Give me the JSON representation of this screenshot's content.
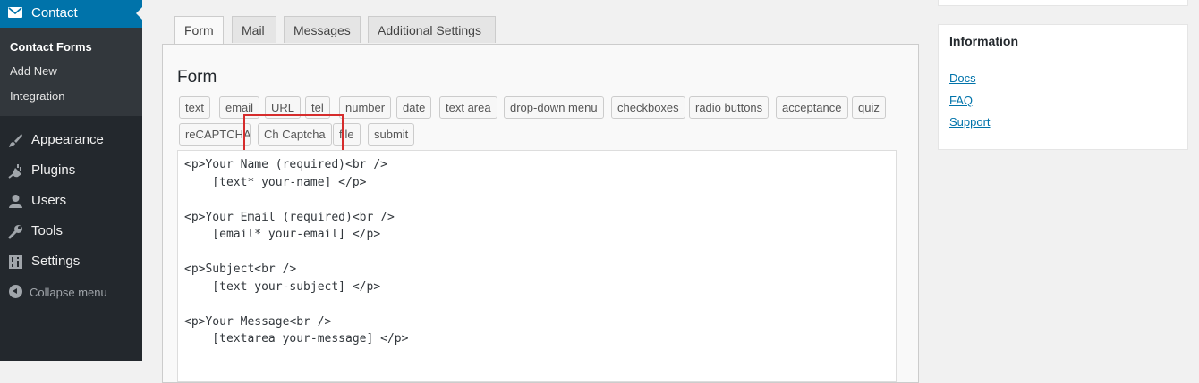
{
  "sidebar": {
    "active": {
      "label": "Contact",
      "icon": "mail-icon"
    },
    "submenu": [
      "Contact Forms",
      "Add New",
      "Integration"
    ],
    "items": [
      {
        "label": "Appearance",
        "icon": "paintbrush-icon"
      },
      {
        "label": "Plugins",
        "icon": "plug-icon"
      },
      {
        "label": "Users",
        "icon": "user-icon"
      },
      {
        "label": "Tools",
        "icon": "wrench-icon"
      },
      {
        "label": "Settings",
        "icon": "settings-icon"
      }
    ],
    "collapse_label": "Collapse menu"
  },
  "tabs": [
    "Form",
    "Mail",
    "Messages",
    "Additional Settings"
  ],
  "panel": {
    "title": "Form",
    "tag_buttons_row1": [
      "text",
      "email",
      "URL",
      "tel",
      "number",
      "date",
      "text area",
      "drop-down menu",
      "checkboxes",
      "radio buttons",
      "acceptance",
      "quiz"
    ],
    "tag_buttons_row2": [
      "reCAPTCHA",
      "Ch Captcha",
      "file",
      "submit"
    ],
    "editor_content": "<p>Your Name (required)<br />\n    [text* your-name] </p>\n\n<p>Your Email (required)<br />\n    [email* your-email] </p>\n\n<p>Subject<br />\n    [text your-subject] </p>\n\n<p>Your Message<br />\n    [textarea your-message] </p>"
  },
  "info_box": {
    "title": "Information",
    "links": [
      "Docs",
      "FAQ",
      "Support"
    ]
  },
  "colors": {
    "accent": "#0073aa",
    "sidebar": "#23282d",
    "highlight": "#d62c2c"
  }
}
